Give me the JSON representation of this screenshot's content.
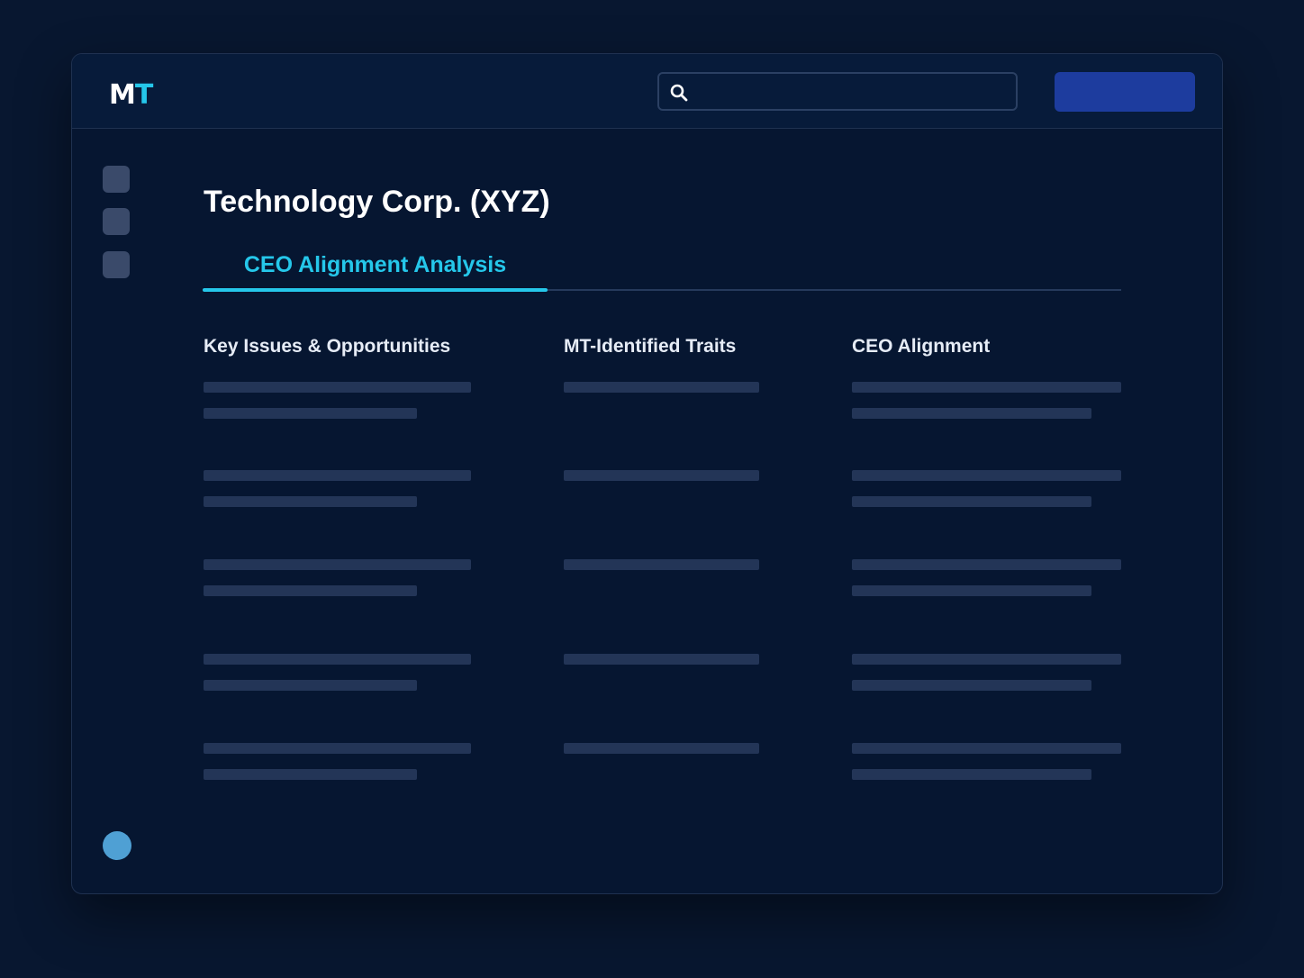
{
  "header": {
    "logo": {
      "left": "M",
      "right": "T",
      "accent_color": "#25c7ea"
    },
    "search": {
      "placeholder": "",
      "value": ""
    },
    "primary_button": {
      "label": "",
      "color": "#1d3c9e"
    }
  },
  "sidebar": {
    "items": [
      {
        "name": "nav-item-1"
      },
      {
        "name": "nav-item-2"
      },
      {
        "name": "nav-item-3"
      }
    ],
    "avatar_color": "#4fa0d4"
  },
  "main": {
    "title": "Technology Corp. (XYZ)",
    "tabs": [
      {
        "label": "CEO Alignment Analysis",
        "active": true
      }
    ],
    "columns": [
      {
        "header": "Key Issues & Opportunities",
        "rows": 5,
        "lines_per_row": 2
      },
      {
        "header": "MT-Identified Traits",
        "rows": 5,
        "lines_per_row": 1
      },
      {
        "header": "CEO Alignment",
        "rows": 5,
        "lines_per_row": 2
      }
    ]
  },
  "colors": {
    "background": "#081730",
    "panel": "#061631",
    "skeleton": "#233557",
    "accent": "#25c7ea"
  }
}
